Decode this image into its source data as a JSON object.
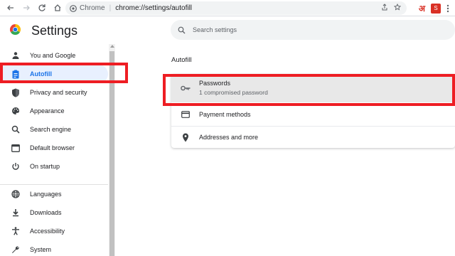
{
  "toolbar": {
    "site_name": "Chrome",
    "url": "chrome://settings/autofill",
    "ext_label": "अ",
    "ext_badge": "S"
  },
  "header": {
    "title": "Settings",
    "search_placeholder": "Search settings"
  },
  "sidebar": {
    "items": [
      {
        "label": "You and Google",
        "icon": "person-icon"
      },
      {
        "label": "Autofill",
        "icon": "clipboard-icon",
        "active": true
      },
      {
        "label": "Privacy and security",
        "icon": "shield-icon"
      },
      {
        "label": "Appearance",
        "icon": "palette-icon"
      },
      {
        "label": "Search engine",
        "icon": "search-icon"
      },
      {
        "label": "Default browser",
        "icon": "browser-icon"
      },
      {
        "label": "On startup",
        "icon": "power-icon"
      },
      {
        "label": "Languages",
        "icon": "globe-icon"
      },
      {
        "label": "Downloads",
        "icon": "download-icon"
      },
      {
        "label": "Accessibility",
        "icon": "accessibility-icon"
      },
      {
        "label": "System",
        "icon": "wrench-icon"
      }
    ]
  },
  "main": {
    "section_title": "Autofill",
    "rows": [
      {
        "title": "Passwords",
        "subtitle": "1 compromised password",
        "icon": "key-icon"
      },
      {
        "title": "Payment methods",
        "icon": "credit-card-icon"
      },
      {
        "title": "Addresses and more",
        "icon": "location-pin-icon"
      }
    ]
  },
  "colors": {
    "accent": "#1a73e8",
    "highlight_box": "#ee1d23",
    "selected_row": "#e8e8e8"
  }
}
